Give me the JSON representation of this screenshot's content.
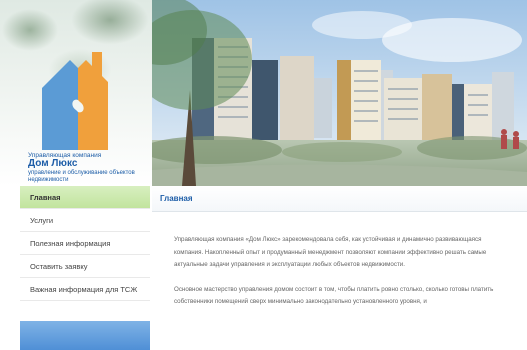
{
  "logo": {
    "label": "Управляющая компания",
    "name": "Дом Люкс",
    "description": "управление и обслуживание объектов недвижимости"
  },
  "nav": [
    {
      "label": "Главная",
      "active": true
    },
    {
      "label": "Услуги",
      "active": false
    },
    {
      "label": "Полезная информация",
      "active": false
    },
    {
      "label": "Оставить заявку",
      "active": false
    },
    {
      "label": "Важная информация для ТСЖ",
      "active": false
    }
  ],
  "content": {
    "heading": "Главная",
    "paragraphs": [
      "Управляющая компания «Дом Люкс» зарекомендовала себя, как устойчивая и динамично развивающаяся компания. Накопленный опыт и продуманный менеджмент позволяют компании эффективно решать самые актуальные задачи управления и эксплуатации любых объектов недвижимости.",
      "Основное мастерство управления домом состоит в том, чтобы платить ровно столько, сколько готовы платить собственники помещений сверх минимально законодательно установленного уровня, и"
    ]
  },
  "colors": {
    "brand_blue": "#1e5ea8",
    "logo_blue": "#5b9bd5",
    "logo_orange": "#f0a03c",
    "active_nav": "#c2e49e"
  }
}
